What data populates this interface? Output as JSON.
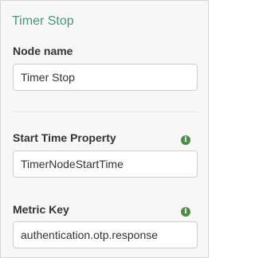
{
  "panel": {
    "title": "Timer Stop"
  },
  "fields": {
    "node_name": {
      "label": "Node name",
      "value": "Timer Stop"
    },
    "start_time_property": {
      "label": "Start Time Property",
      "value": "TimerNodeStartTime",
      "info_icon": "info-icon"
    },
    "metric_key": {
      "label": "Metric Key",
      "value": "authentication.otp.response",
      "info_icon": "info-icon"
    }
  },
  "colors": {
    "title": "#4d9477",
    "info_icon": "#4b8c4b",
    "panel_background": "#f7f7f7"
  }
}
